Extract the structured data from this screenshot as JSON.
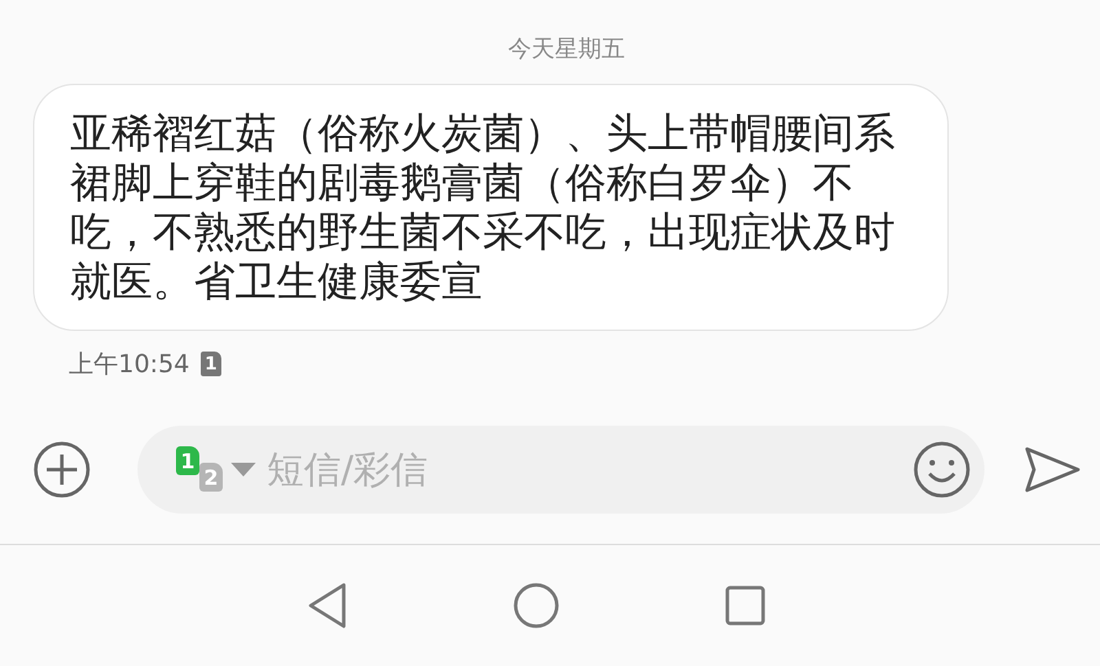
{
  "date_header": "今天星期五",
  "message": {
    "text": "亚稀褶红菇（俗称火炭菌）、头上带帽腰间系裙脚上穿鞋的剧毒鹅膏菌（俗称白罗伞）不吃，不熟悉的野生菌不采不吃，出现症状及时就医。省卫生健康委宣",
    "time": "上午10:54",
    "sim": "1"
  },
  "composer": {
    "sims": [
      {
        "label": "1",
        "selected": true
      },
      {
        "label": "2",
        "selected": false
      }
    ],
    "placeholder": "短信/彩信"
  }
}
